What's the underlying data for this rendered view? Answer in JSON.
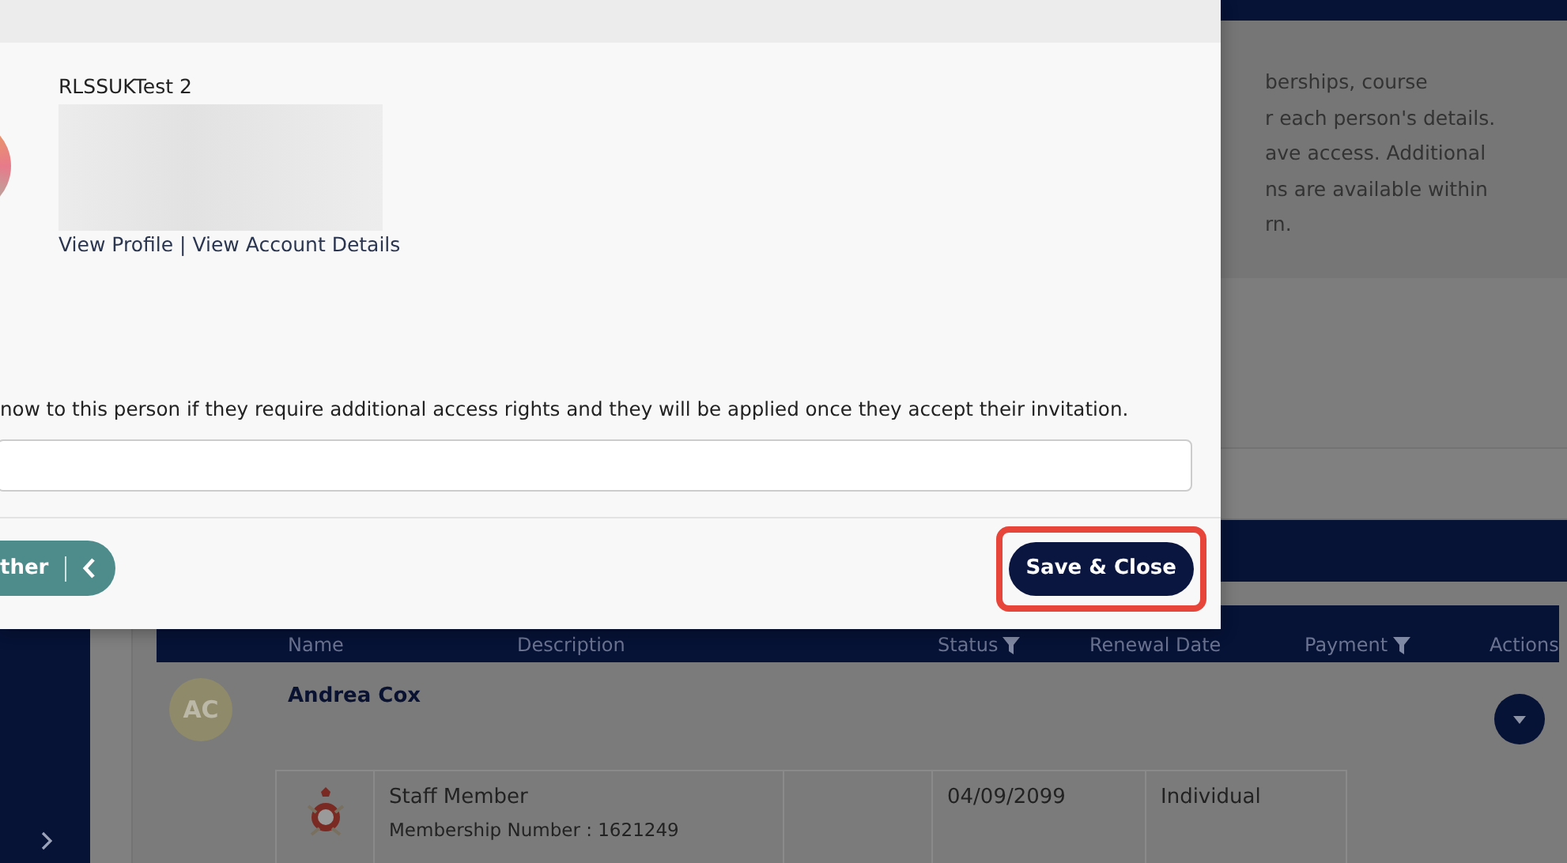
{
  "modal": {
    "account_name": "RLSSUKTest 2",
    "links": [
      "View Profile",
      "View Account Details"
    ],
    "link_separator": "|",
    "note": "now to this person if they require additional access rights and they will be applied once they accept their invitation.",
    "back_button": {
      "label": "ther"
    },
    "save_button": {
      "label": "Save & Close",
      "highlighted": true
    }
  },
  "info_card": {
    "lines": [
      "berships, course",
      "r each person's details.",
      "ave access. Additional",
      "ns are available within",
      "rn."
    ]
  },
  "table": {
    "columns": [
      {
        "label": "Name",
        "filter": false
      },
      {
        "label": "Description",
        "filter": false
      },
      {
        "label": "Status",
        "filter": true
      },
      {
        "label": "Renewal Date",
        "filter": false
      },
      {
        "label": "Payment",
        "filter": true
      },
      {
        "label": "Actions",
        "filter": false
      }
    ],
    "rows": [
      {
        "initials": "AC",
        "name": "Andrea Cox",
        "memberships": [
          {
            "title": "Staff Member",
            "number": "Membership Number : 1621249",
            "renewal_date": "04/09/2099",
            "payment": "Individual"
          }
        ]
      }
    ]
  }
}
